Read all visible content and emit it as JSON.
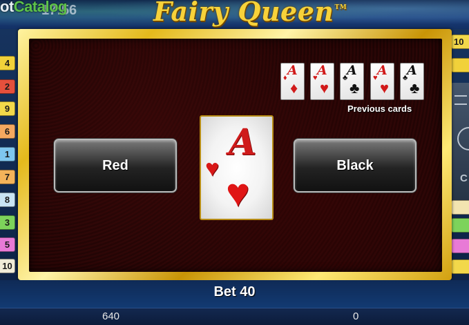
{
  "header": {
    "watermark_prefix": "ot",
    "watermark_highlight": "Catalog",
    "clock": "17:56",
    "game_title": "Fairy Queen",
    "trademark": "TM"
  },
  "gamble": {
    "previous_cards_label": "Previous cards",
    "previous_cards": [
      {
        "rank": "A",
        "suit": "♦",
        "color": "red"
      },
      {
        "rank": "A",
        "suit": "♥",
        "color": "red"
      },
      {
        "rank": "A",
        "suit": "♣",
        "color": "black"
      },
      {
        "rank": "A",
        "suit": "♥",
        "color": "red"
      },
      {
        "rank": "A",
        "suit": "♣",
        "color": "black"
      }
    ],
    "current_card": {
      "rank": "A",
      "suit": "♥",
      "color": "red"
    },
    "red_button": "Red",
    "black_button": "Black"
  },
  "paylines": {
    "left": [
      "4",
      "2",
      "9",
      "6",
      "1",
      "7",
      "8",
      "3",
      "5",
      "10"
    ],
    "right": [
      "10"
    ]
  },
  "right_panel": {
    "letter": "C"
  },
  "footer": {
    "bet": "Bet 40",
    "balance": "640",
    "win": "0"
  },
  "colors": {
    "frame_gold": "#e4b91c",
    "felt": "#240505",
    "button": "#232323",
    "card_red": "#d11a1a"
  }
}
